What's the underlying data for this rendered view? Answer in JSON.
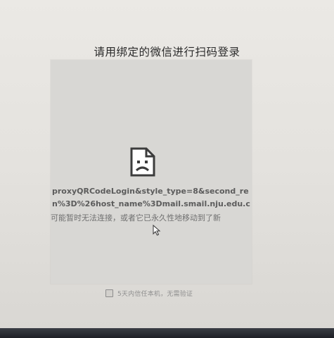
{
  "page": {
    "title": "请用绑定的微信进行扫码登录"
  },
  "qr_panel": {
    "error_icon": "sad-document-icon",
    "url_line_1": "proxyQRCodeLogin&style_type=8&second_re",
    "url_line_2": "n%3D%26host_name%3Dmail.smail.nju.edu.c",
    "error_message": "可能暂时无法连接，或者它已永久性地移动到了新"
  },
  "remember": {
    "label": "5天内信任本机，无需验证",
    "checked": false
  },
  "cursor_icon": "mouse-pointer-icon"
}
